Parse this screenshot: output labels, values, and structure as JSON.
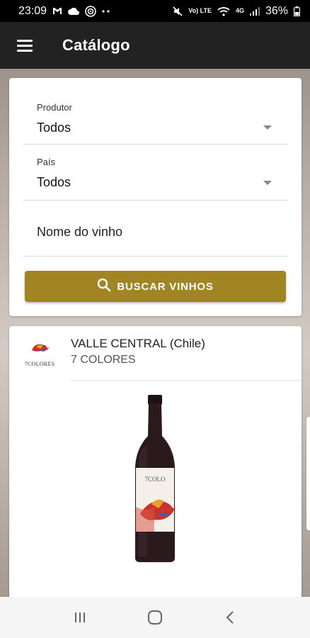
{
  "status_bar": {
    "time": "23:09",
    "battery": "36%",
    "left_icons": [
      "gmail-icon",
      "cloud-icon",
      "location-icon",
      "more-dots-icon"
    ],
    "right_icons": [
      "mute-icon",
      "volte-icon",
      "wifi-icon",
      "signal-icon",
      "battery-icon"
    ],
    "volte_label": "Vo) LTE",
    "network_label": "4G"
  },
  "app_bar": {
    "title": "Catálogo",
    "background": "#222222"
  },
  "filters": {
    "producer": {
      "label": "Produtor",
      "value": "Todos"
    },
    "country": {
      "label": "País",
      "value": "Todos"
    },
    "wine_name": {
      "placeholder": "Nome do vinho"
    },
    "search_button": {
      "label": "BUSCAR VINHOS",
      "color": "#a08522"
    }
  },
  "product": {
    "region": "VALLE CENTRAL (Chile)",
    "producer": "7 COLORES",
    "logo_text": "7COLORES"
  },
  "nav_bar": {
    "icons": [
      "recent-apps-icon",
      "home-icon",
      "back-icon"
    ]
  }
}
